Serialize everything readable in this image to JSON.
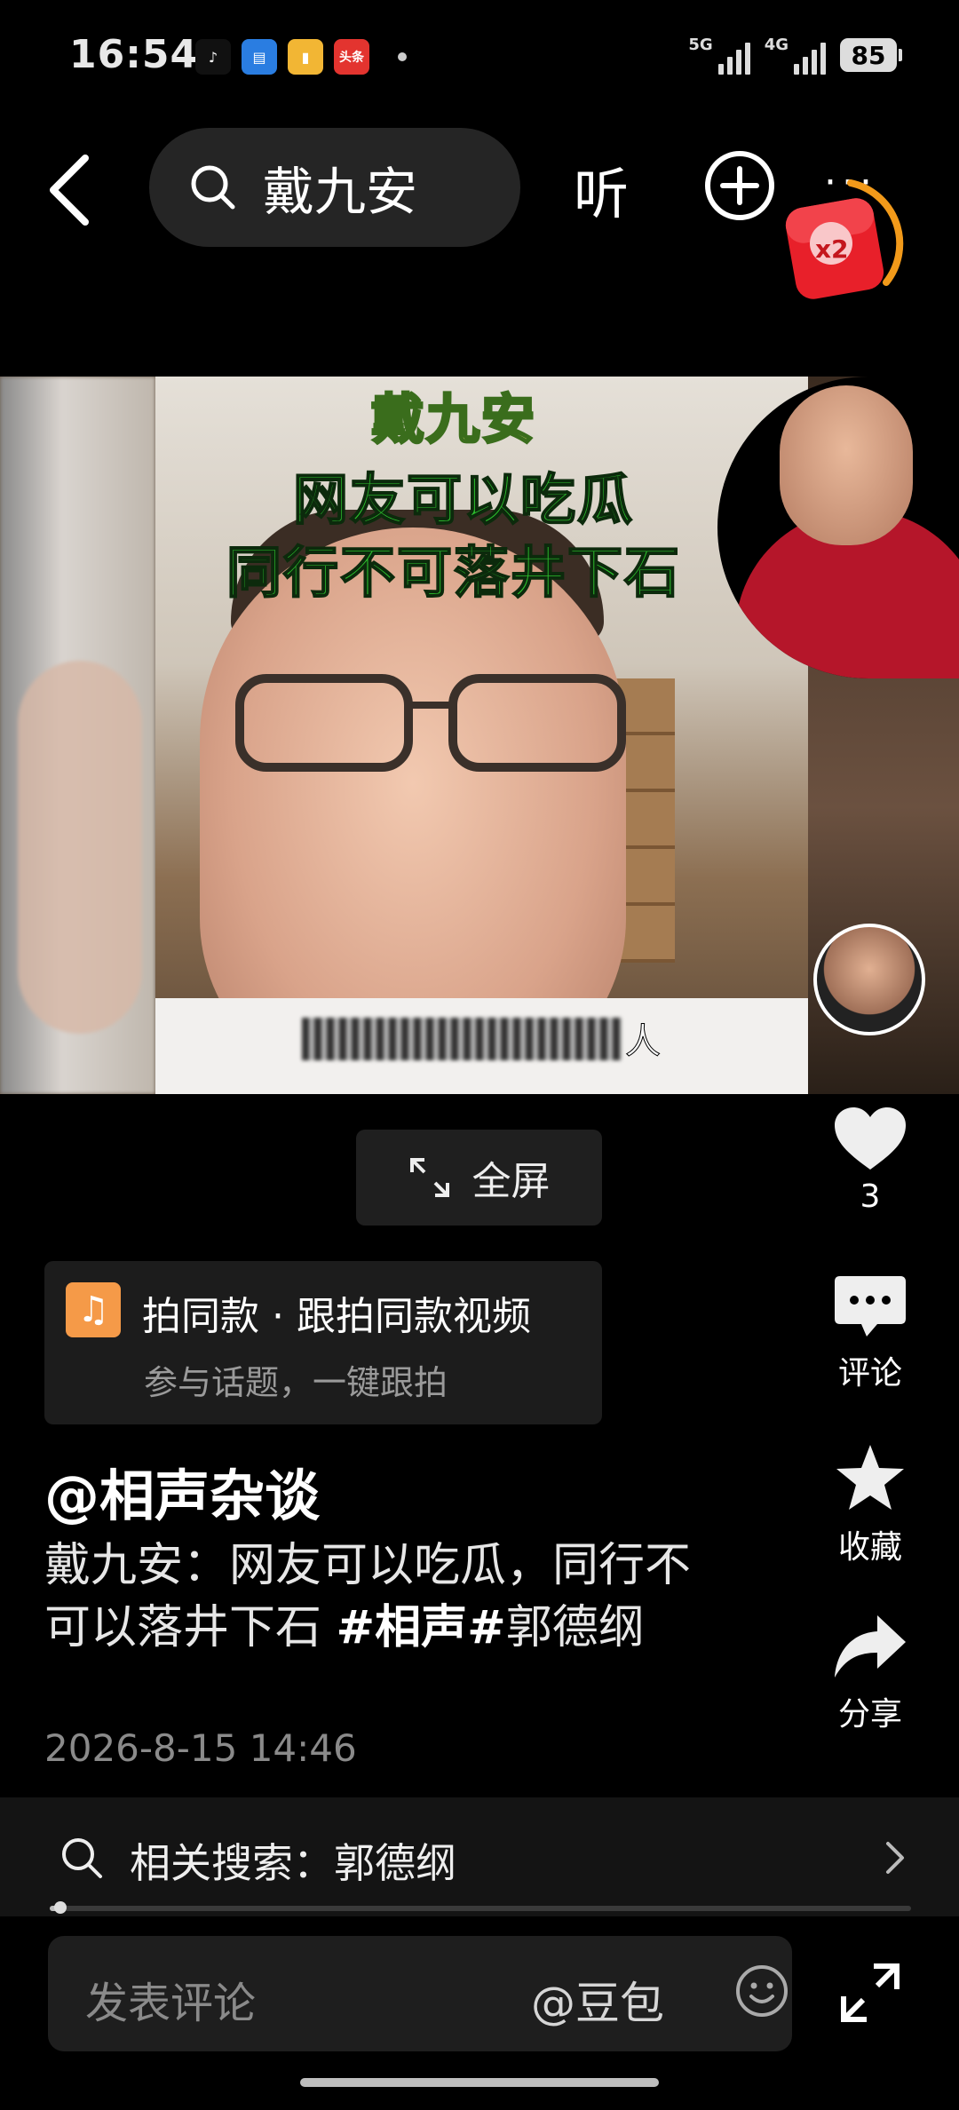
{
  "status_bar": {
    "time": "16:54",
    "app_icons": [
      {
        "name": "tiktok-icon",
        "glyph": "♪",
        "color": "#111111"
      },
      {
        "name": "wallet-app-icon",
        "glyph": "▤",
        "color": "#2a7de1"
      },
      {
        "name": "reader-app-icon",
        "glyph": "▮",
        "color": "#f2b634"
      },
      {
        "name": "toutiao-icon",
        "glyph": "头条",
        "color": "#e3342f"
      }
    ],
    "network_1": "5G",
    "network_2": "4G",
    "battery": "85"
  },
  "top_bar": {
    "search_text": "戴九安",
    "listen_label": "听",
    "more_label": "···",
    "redpacket_label": "x2"
  },
  "video": {
    "overlay_name": "戴九安",
    "overlay_line1": "网友可以吃瓜",
    "overlay_line2": "同行不可落井下石",
    "subtitle_tail": "人"
  },
  "fullscreen": {
    "label": "全屏"
  },
  "actions": {
    "like_count": "3",
    "comment_label": "评论",
    "favorite_label": "收藏",
    "share_label": "分享"
  },
  "template_card": {
    "icon": "♫",
    "title": "拍同款 · 跟拍同款视频",
    "subtitle": "参与话题，一键跟拍"
  },
  "post": {
    "author": "@相声杂谈",
    "desc_text": "戴九安：网友可以吃瓜，同行不可以落井下石 ",
    "tag1": "#相声#",
    "tag2_text": "郭德纲",
    "date": "2026-8-15 14:46"
  },
  "related": {
    "label": "相关搜索：郭德纲"
  },
  "playback": {
    "progress": 0.012
  },
  "comment_bar": {
    "placeholder": "发表评论",
    "mention": "@豆包"
  }
}
